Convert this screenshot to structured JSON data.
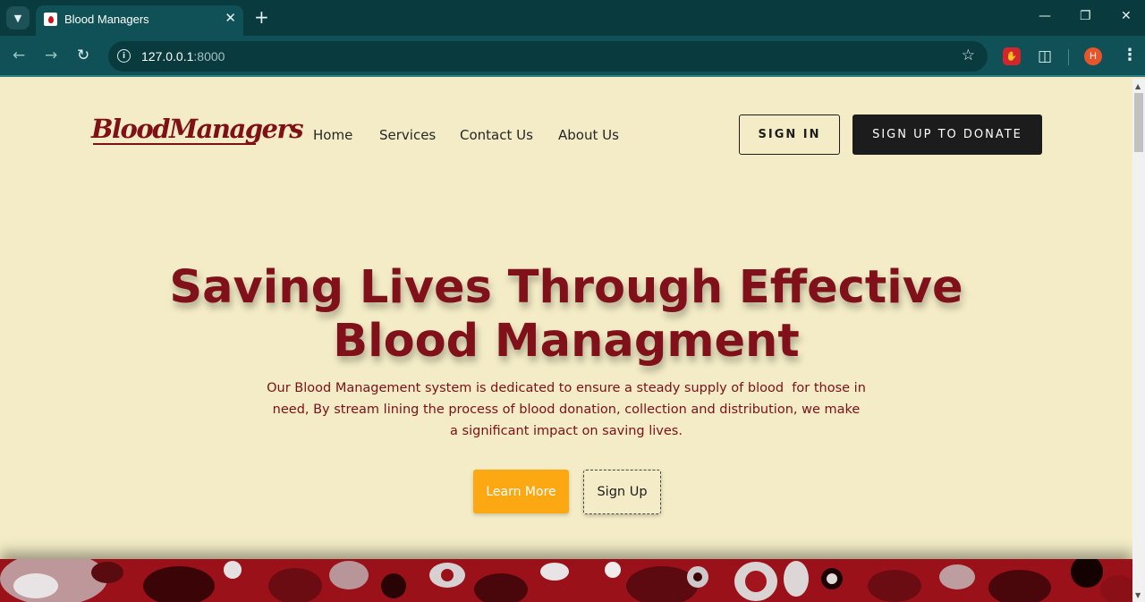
{
  "browser": {
    "tab_title": "Blood Managers",
    "url_host": "127.0.0.1",
    "url_port": ":8000",
    "profile_initial": "H"
  },
  "site": {
    "logo": "BloodManagers",
    "nav": [
      "Home",
      "Services",
      "Contact Us",
      "About Us"
    ],
    "sign_in": "SIGN IN",
    "sign_up_donate": "SIGN UP TO DONATE"
  },
  "hero": {
    "title_line1": "Saving Lives Through Effective",
    "title_line2": "Blood Managment",
    "description_line1": "Our Blood Management system is dedicated to ensure a steady supply of blood  for those in",
    "description_line2": "need, By stream lining the process of blood donation, collection and distribution, we make",
    "description_line3": "a significant impact on saving lives.",
    "learn_more": "Learn More",
    "sign_up": "Sign Up"
  },
  "colors": {
    "page_background": "#f3ecc6",
    "brand_red": "#80111a",
    "accent_orange": "#fca812",
    "dark_button": "#1c1c1c",
    "browser_frame": "#093b3e"
  }
}
